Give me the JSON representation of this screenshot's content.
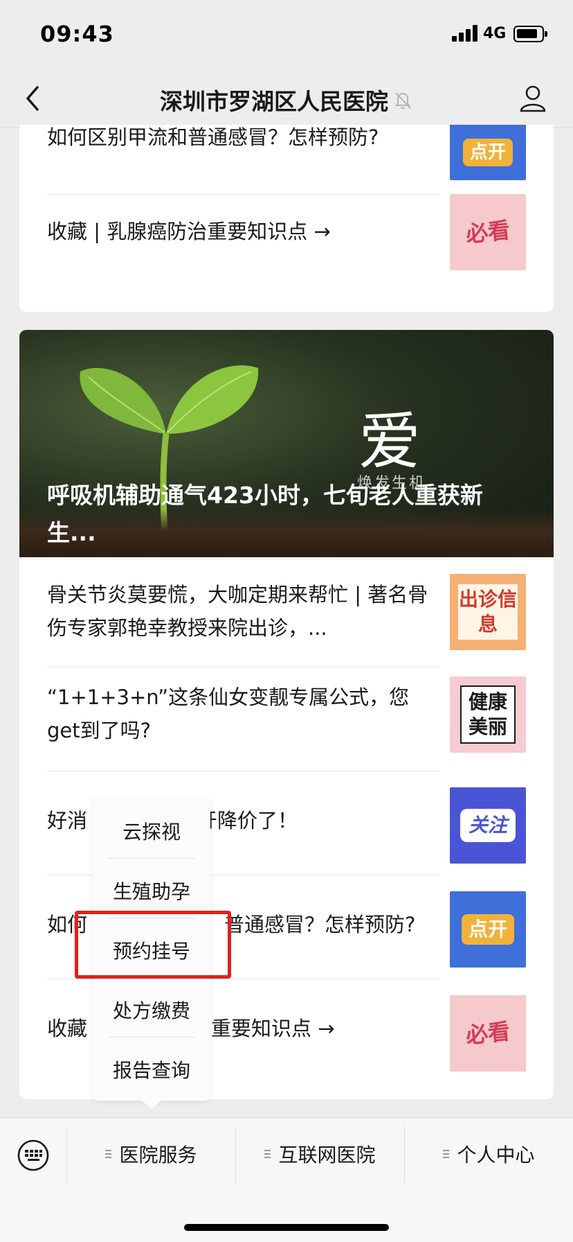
{
  "status": {
    "time": "09:43",
    "network": "4G"
  },
  "nav": {
    "title": "深圳市罗湖区人民医院"
  },
  "top_card": {
    "articles": [
      {
        "title": "如何区别甲流和普通感冒？怎样预防?",
        "thumb_text": "点开",
        "thumb_bg": "#3f6fd8"
      },
      {
        "title": "收藏 | 乳腺癌防治重要知识点 →",
        "thumb_text": "必看",
        "thumb_bg": "#f6c9cc"
      }
    ]
  },
  "hero": {
    "title": "呼吸机辅助通气423小时，七旬老人重获新生...",
    "overlay_big": "爱",
    "overlay_small": "焕发生机"
  },
  "main_card": {
    "articles": [
      {
        "title": "骨关节炎莫要慌，大咖定期来帮忙 | 著名骨伤专家郭艳幸教授来院出诊，...",
        "thumb_text": "出诊信息",
        "thumb_bg": "#f5b074"
      },
      {
        "title": "“1+1+3+n”这条仙女变靓专属公式，您get到了吗?",
        "thumb_text": "健康美丽",
        "thumb_bg": "#f6cbd1"
      },
      {
        "title": "好消息！种植牙降价了！",
        "visible_prefix": "好消",
        "visible_suffix": "植牙降价了！",
        "thumb_text": "关注",
        "thumb_bg": "#4a55d6"
      },
      {
        "title": "如何区别甲流和普通感冒？怎样预防?",
        "visible_prefix": "如何",
        "visible_suffix": "普通感冒？怎样预防?",
        "thumb_text": "点开",
        "thumb_bg": "#3f6fd8"
      },
      {
        "title": "收藏 | 乳腺癌防治重要知识点 →",
        "visible_prefix": "收藏",
        "visible_suffix": "治重要知识点 →",
        "thumb_text": "必看",
        "thumb_bg": "#f6c9cc"
      }
    ]
  },
  "submenu": {
    "items": [
      "云探视",
      "生殖助孕",
      "预约挂号",
      "处方缴费",
      "报告查询"
    ],
    "highlighted": "预约挂号"
  },
  "menubar": {
    "items": [
      "医院服务",
      "互联网医院",
      "个人中心"
    ]
  },
  "icons": {
    "back": "chevron-left-icon",
    "mute": "bell-off-icon",
    "profile": "person-icon",
    "keyboard": "keyboard-icon"
  },
  "colors": {
    "highlight": "#e02020",
    "accent_blue": "#3f6fd8",
    "pink": "#f6c9cc"
  }
}
